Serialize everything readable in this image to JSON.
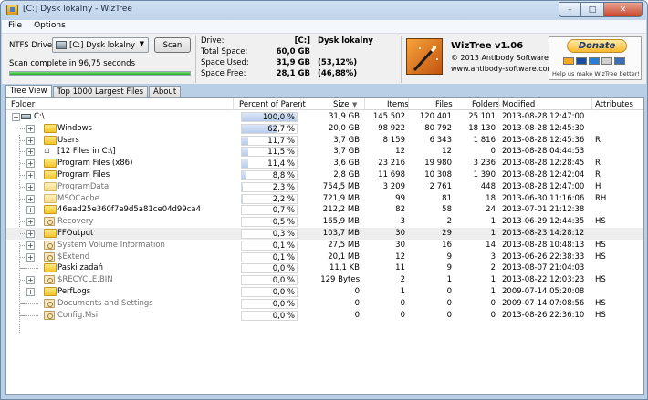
{
  "window": {
    "title": "[C:] Dysk lokalny - WizTree",
    "min_glyph": "–",
    "max_glyph": "□",
    "close_glyph": "✕"
  },
  "menu": [
    "File",
    "Options"
  ],
  "scan": {
    "drive_label": "NTFS Drive:",
    "drive_value": "[C:] Dysk lokalny",
    "scan_button": "Scan",
    "status": "Scan complete in 96,75 seconds",
    "progress": 1.0
  },
  "drive_info": {
    "drive": {
      "label": "Drive:",
      "value": "[C:]",
      "extra": "Dysk lokalny"
    },
    "total": {
      "label": "Total Space:",
      "value": "60,0 GB",
      "extra": ""
    },
    "used": {
      "label": "Space Used:",
      "value": "31,9 GB",
      "extra": "(53,12%)"
    },
    "free": {
      "label": "Space Free:",
      "value": "28,1 GB",
      "extra": "(46,88%)"
    }
  },
  "about": {
    "name": "WizTree v1.06",
    "copyright": "© 2013 Antibody Software",
    "website": "www.antibody-software.com"
  },
  "donate": {
    "button": "Donate",
    "text": "Help us make WizTree better!",
    "card_colors": [
      "#f5a623",
      "#1a4fa0",
      "#2a7fd0",
      "#d0d0d0",
      "#3b6fb6"
    ]
  },
  "tabs": [
    "Tree View",
    "Top 1000 Largest Files",
    "About"
  ],
  "columns": {
    "folder": "Folder",
    "percent": "Percent of Parent",
    "size": "Size",
    "size_sort": "▼",
    "items": "Items",
    "files": "Files",
    "folders": "Folders",
    "modified": "Modified",
    "attributes": "Attributes"
  },
  "root": {
    "name": "C:\\",
    "expander": "−",
    "percent": "100,0 %",
    "pct": 1.0,
    "size": "31,9 GB",
    "items": "145 502",
    "files": "120 401",
    "folders": "25 101",
    "modified": "2013-08-28 12:47:00",
    "attributes": ""
  },
  "rows": [
    {
      "name": "Windows",
      "icon": "folder",
      "expander": "+",
      "dim": false,
      "percent": "62,7 %",
      "pct": 0.627,
      "size": "20,0 GB",
      "items": "98 922",
      "files": "80 792",
      "folders": "18 130",
      "modified": "2013-08-28 12:45:30",
      "attributes": ""
    },
    {
      "name": "Users",
      "icon": "folder",
      "expander": "+",
      "dim": false,
      "percent": "11,7 %",
      "pct": 0.117,
      "size": "3,7 GB",
      "items": "8 159",
      "files": "6 343",
      "folders": "1 816",
      "modified": "2013-08-28 12:45:36",
      "attributes": "R"
    },
    {
      "name": "[12 Files in C:\\]",
      "icon": "files",
      "expander": "+",
      "dim": false,
      "percent": "11,5 %",
      "pct": 0.115,
      "size": "3,7 GB",
      "items": "12",
      "files": "12",
      "folders": "0",
      "modified": "2013-08-28 04:44:53",
      "attributes": ""
    },
    {
      "name": "Program Files (x86)",
      "icon": "folder",
      "expander": "+",
      "dim": false,
      "percent": "11,4 %",
      "pct": 0.114,
      "size": "3,6 GB",
      "items": "23 216",
      "files": "19 980",
      "folders": "3 236",
      "modified": "2013-08-28 12:28:45",
      "attributes": "R"
    },
    {
      "name": "Program Files",
      "icon": "folder",
      "expander": "+",
      "dim": false,
      "percent": "8,8 %",
      "pct": 0.088,
      "size": "2,8 GB",
      "items": "11 698",
      "files": "10 308",
      "folders": "1 390",
      "modified": "2013-08-28 12:42:04",
      "attributes": "R"
    },
    {
      "name": "ProgramData",
      "icon": "folder-dim",
      "expander": "+",
      "dim": true,
      "percent": "2,3 %",
      "pct": 0.023,
      "size": "754,5 MB",
      "items": "3 209",
      "files": "2 761",
      "folders": "448",
      "modified": "2013-08-28 12:47:00",
      "attributes": "H"
    },
    {
      "name": "MSOCache",
      "icon": "folder-dim",
      "expander": "+",
      "dim": true,
      "percent": "2,2 %",
      "pct": 0.022,
      "size": "721,9 MB",
      "items": "99",
      "files": "81",
      "folders": "18",
      "modified": "2013-06-30 11:16:06",
      "attributes": "RH"
    },
    {
      "name": "46ead25e360f7e9d5a81ce04d99ca4",
      "icon": "folder",
      "expander": "+",
      "dim": false,
      "percent": "0,7 %",
      "pct": 0.007,
      "size": "212,2 MB",
      "items": "82",
      "files": "58",
      "folders": "24",
      "modified": "2013-07-01 21:12:38",
      "attributes": ""
    },
    {
      "name": "Recovery",
      "icon": "sysfolder",
      "expander": "+",
      "dim": true,
      "percent": "0,5 %",
      "pct": 0.005,
      "size": "165,9 MB",
      "items": "3",
      "files": "2",
      "folders": "1",
      "modified": "2013-06-29 12:44:35",
      "attributes": "HS"
    },
    {
      "name": "FFOutput",
      "icon": "folder",
      "expander": "+",
      "dim": false,
      "selected": true,
      "percent": "0,3 %",
      "pct": 0.003,
      "size": "103,7 MB",
      "items": "30",
      "files": "29",
      "folders": "1",
      "modified": "2013-08-23 14:28:12",
      "attributes": ""
    },
    {
      "name": "System Volume Information",
      "icon": "sysfolder",
      "expander": "+",
      "dim": true,
      "percent": "0,1 %",
      "pct": 0.001,
      "size": "27,5 MB",
      "items": "30",
      "files": "16",
      "folders": "14",
      "modified": "2013-08-28 10:48:13",
      "attributes": "HS"
    },
    {
      "name": "$Extend",
      "icon": "sysfolder",
      "expander": "+",
      "dim": true,
      "percent": "0,1 %",
      "pct": 0.001,
      "size": "20,1 MB",
      "items": "12",
      "files": "9",
      "folders": "3",
      "modified": "2013-06-26 22:38:33",
      "attributes": "HS"
    },
    {
      "name": "Paski zadań",
      "icon": "folder",
      "expander": "",
      "dim": false,
      "percent": "0,0 %",
      "pct": 0.0,
      "size": "11,1 KB",
      "items": "11",
      "files": "9",
      "folders": "2",
      "modified": "2013-08-07 21:04:03",
      "attributes": ""
    },
    {
      "name": "$RECYCLE.BIN",
      "icon": "sysfolder",
      "expander": "+",
      "dim": true,
      "percent": "0,0 %",
      "pct": 0.0,
      "size": "129 Bytes",
      "items": "2",
      "files": "1",
      "folders": "1",
      "modified": "2013-08-22 12:03:23",
      "attributes": "HS"
    },
    {
      "name": "PerfLogs",
      "icon": "folder",
      "expander": "+",
      "dim": false,
      "percent": "0,0 %",
      "pct": 0.0,
      "size": "0",
      "items": "1",
      "files": "0",
      "folders": "1",
      "modified": "2009-07-14 05:20:08",
      "attributes": ""
    },
    {
      "name": "Documents and Settings",
      "icon": "sysfolder",
      "expander": "",
      "dim": true,
      "percent": "0,0 %",
      "pct": 0.0,
      "size": "0",
      "items": "0",
      "files": "0",
      "folders": "0",
      "modified": "2009-07-14 07:08:56",
      "attributes": "HS"
    },
    {
      "name": "Config.Msi",
      "icon": "sysfolder",
      "expander": "",
      "dim": true,
      "percent": "0,0 %",
      "pct": 0.0,
      "size": "0",
      "items": "0",
      "files": "0",
      "folders": "0",
      "modified": "2013-08-26 22:36:10",
      "attributes": "HS"
    }
  ]
}
